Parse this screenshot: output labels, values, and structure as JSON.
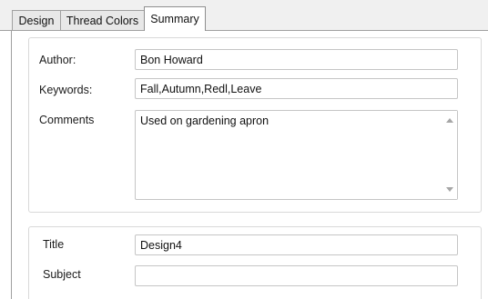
{
  "tabs": [
    {
      "label": "Design"
    },
    {
      "label": "Thread Colors"
    },
    {
      "label": "Summary",
      "selected": true
    }
  ],
  "summary": {
    "author": {
      "label": "Author:",
      "value": "Bon Howard"
    },
    "keywords": {
      "label": "Keywords:",
      "value": "Fall,Autumn,Redl,Leave"
    },
    "comments": {
      "label": "Comments",
      "value": "Used on gardening apron"
    },
    "title": {
      "label": "Title",
      "value": "Design4"
    },
    "subject": {
      "label": "Subject",
      "value": ""
    }
  },
  "icons": {
    "scroll_up": "triangle-up-icon",
    "scroll_down": "triangle-down-icon"
  },
  "colors": {
    "tab_border": "#a0a0a0",
    "group_border": "#d9d9d9",
    "field_border": "#c5c5c5"
  }
}
